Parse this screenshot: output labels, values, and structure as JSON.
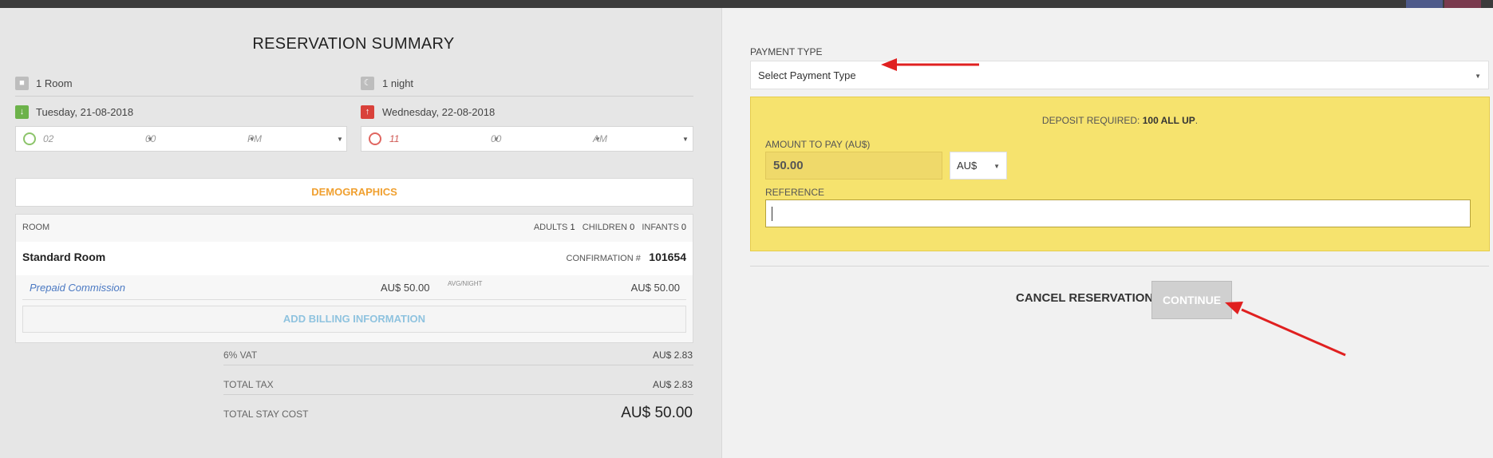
{
  "summary": {
    "title": "RESERVATION SUMMARY",
    "rooms": "1 Room",
    "nights": "1 night",
    "checkin_date": "Tuesday, 21-08-2018",
    "checkout_date": "Wednesday, 22-08-2018",
    "checkin_time": {
      "hour": "02",
      "minute": "00",
      "ampm": "PM"
    },
    "checkout_time": {
      "hour": "11",
      "minute": "00",
      "ampm": "AM"
    },
    "demographics_label": "DEMOGRAPHICS",
    "room_label": "ROOM",
    "adults_label": "ADULTS",
    "adults": "1",
    "children_label": "CHILDREN",
    "children": "0",
    "infants_label": "INFANTS",
    "infants": "0",
    "room_name": "Standard Room",
    "confirmation_label": "CONFIRMATION #",
    "confirmation_number": "101654",
    "rate_name": "Prepaid Commission",
    "avg_rate": "AU$ 50.00",
    "avg_label": "AVG/NIGHT",
    "rate_total": "AU$ 50.00",
    "add_billing_label": "ADD BILLING INFORMATION",
    "vat_label": "6% VAT",
    "vat_value": "AU$ 2.83",
    "total_tax_label": "TOTAL TAX",
    "total_tax_value": "AU$ 2.83",
    "total_stay_label": "TOTAL STAY COST",
    "total_stay_value": "AU$ 50.00"
  },
  "payment": {
    "type_label": "PAYMENT TYPE",
    "type_placeholder": "Select Payment Type",
    "deposit_prefix": "DEPOSIT REQUIRED:",
    "deposit_value": "100 ALL UP",
    "deposit_suffix": ".",
    "amount_label": "AMOUNT TO PAY (AU$)",
    "amount_value": "50.00",
    "currency": "AU$",
    "reference_label": "REFERENCE",
    "reference_value": ""
  },
  "actions": {
    "cancel_label": "CANCEL RESERVATION",
    "continue_label": "CONTINUE"
  },
  "icons": {
    "room": "bed-icon",
    "night": "moon-icon",
    "arrival": "arrow-down-icon",
    "departure": "arrow-up-icon",
    "clock": "clock-icon",
    "caret": "caret-down-icon"
  },
  "colors": {
    "demographics": "#f0a030",
    "link": "#4a78c2",
    "add_billing": "#8fc3df",
    "deposit_panel": "#f6e36e",
    "annotation_arrow": "#e02020",
    "arrival_icon": "#6cb24a",
    "departure_icon": "#d9413a"
  }
}
